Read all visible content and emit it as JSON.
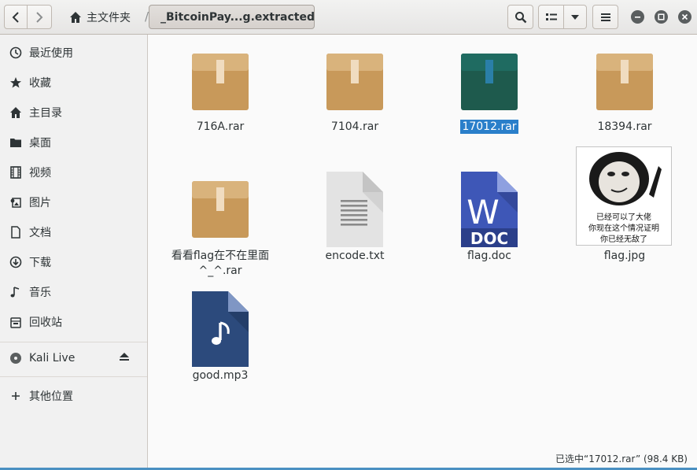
{
  "header": {
    "home_label": "主文件夹",
    "current_folder": "_BitcoinPay...g.extracted"
  },
  "sidebar": {
    "items": [
      {
        "label": "最近使用",
        "icon": "clock-icon"
      },
      {
        "label": "收藏",
        "icon": "star-icon"
      },
      {
        "label": "主目录",
        "icon": "home-icon"
      },
      {
        "label": "桌面",
        "icon": "folder-icon"
      },
      {
        "label": "视频",
        "icon": "film-icon"
      },
      {
        "label": "图片",
        "icon": "picture-icon"
      },
      {
        "label": "文档",
        "icon": "document-icon"
      },
      {
        "label": "下载",
        "icon": "download-icon"
      },
      {
        "label": "音乐",
        "icon": "music-icon"
      },
      {
        "label": "回收站",
        "icon": "trash-icon"
      }
    ],
    "device": {
      "label": "Kali Live",
      "icon": "disc-icon"
    },
    "other": {
      "label": "其他位置",
      "icon": "plus-icon"
    }
  },
  "files": [
    {
      "name": "716A.rar",
      "type": "archive"
    },
    {
      "name": "7104.rar",
      "type": "archive"
    },
    {
      "name": "17012.rar",
      "type": "archive",
      "selected": true
    },
    {
      "name": "18394.rar",
      "type": "archive"
    },
    {
      "name_lines": [
        "看看flag在不在里面",
        "^_^.rar"
      ],
      "type": "archive"
    },
    {
      "name": "encode.txt",
      "type": "text"
    },
    {
      "name": "flag.doc",
      "type": "word",
      "badge_letter": "W",
      "badge_text": "DOC"
    },
    {
      "name": "flag.jpg",
      "type": "image",
      "caption_lines": [
        "已经可以了大佬",
        "你现在这个情况证明",
        "你已经无敌了"
      ]
    },
    {
      "name": "good.mp3",
      "type": "audio"
    }
  ],
  "status": {
    "text": "已选中“17012.rar”  (98.4 KB)"
  },
  "colors": {
    "selection": "#2a7fca",
    "archive": "#c8995a",
    "archive_selected": "#1e5a4d",
    "word": "#3e57b7",
    "audio": "#2c4a7c"
  }
}
